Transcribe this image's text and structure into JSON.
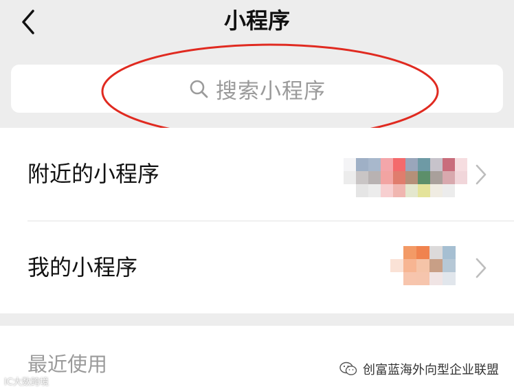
{
  "header": {
    "title": "小程序",
    "back_icon": "chevron-left-icon"
  },
  "search": {
    "placeholder": "搜索小程序",
    "icon": "search-icon",
    "annotation_color": "#e02a20"
  },
  "list": {
    "items": [
      {
        "label": "附近的小程序",
        "icon": "chevron-right-icon"
      },
      {
        "label": "我的小程序",
        "icon": "chevron-right-icon"
      }
    ]
  },
  "recent": {
    "label": "最近使用"
  },
  "watermark": {
    "text": "创富蓝海外向型企业联盟",
    "corner_text": "IC大数跨境"
  },
  "colors": {
    "background": "#ededed",
    "card": "#ffffff",
    "text": "#111111",
    "muted": "#9a9a9a",
    "chevron": "#bdbdbd"
  }
}
